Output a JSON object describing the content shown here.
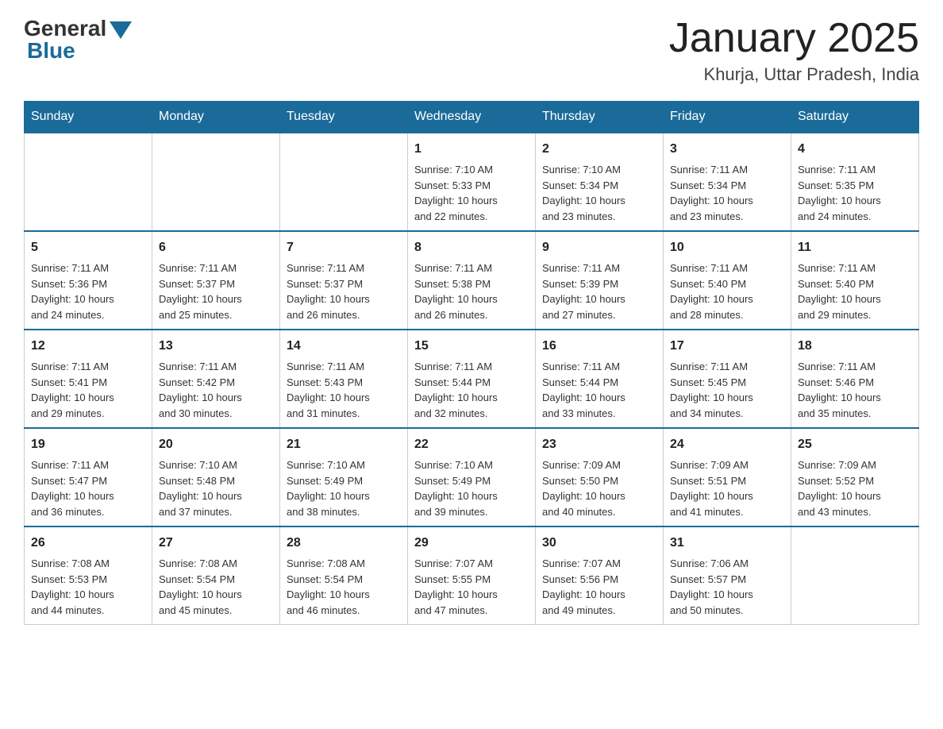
{
  "logo": {
    "general": "General",
    "blue": "Blue"
  },
  "title": "January 2025",
  "subtitle": "Khurja, Uttar Pradesh, India",
  "days": [
    "Sunday",
    "Monday",
    "Tuesday",
    "Wednesday",
    "Thursday",
    "Friday",
    "Saturday"
  ],
  "weeks": [
    [
      {
        "day": "",
        "info": ""
      },
      {
        "day": "",
        "info": ""
      },
      {
        "day": "",
        "info": ""
      },
      {
        "day": "1",
        "info": "Sunrise: 7:10 AM\nSunset: 5:33 PM\nDaylight: 10 hours\nand 22 minutes."
      },
      {
        "day": "2",
        "info": "Sunrise: 7:10 AM\nSunset: 5:34 PM\nDaylight: 10 hours\nand 23 minutes."
      },
      {
        "day": "3",
        "info": "Sunrise: 7:11 AM\nSunset: 5:34 PM\nDaylight: 10 hours\nand 23 minutes."
      },
      {
        "day": "4",
        "info": "Sunrise: 7:11 AM\nSunset: 5:35 PM\nDaylight: 10 hours\nand 24 minutes."
      }
    ],
    [
      {
        "day": "5",
        "info": "Sunrise: 7:11 AM\nSunset: 5:36 PM\nDaylight: 10 hours\nand 24 minutes."
      },
      {
        "day": "6",
        "info": "Sunrise: 7:11 AM\nSunset: 5:37 PM\nDaylight: 10 hours\nand 25 minutes."
      },
      {
        "day": "7",
        "info": "Sunrise: 7:11 AM\nSunset: 5:37 PM\nDaylight: 10 hours\nand 26 minutes."
      },
      {
        "day": "8",
        "info": "Sunrise: 7:11 AM\nSunset: 5:38 PM\nDaylight: 10 hours\nand 26 minutes."
      },
      {
        "day": "9",
        "info": "Sunrise: 7:11 AM\nSunset: 5:39 PM\nDaylight: 10 hours\nand 27 minutes."
      },
      {
        "day": "10",
        "info": "Sunrise: 7:11 AM\nSunset: 5:40 PM\nDaylight: 10 hours\nand 28 minutes."
      },
      {
        "day": "11",
        "info": "Sunrise: 7:11 AM\nSunset: 5:40 PM\nDaylight: 10 hours\nand 29 minutes."
      }
    ],
    [
      {
        "day": "12",
        "info": "Sunrise: 7:11 AM\nSunset: 5:41 PM\nDaylight: 10 hours\nand 29 minutes."
      },
      {
        "day": "13",
        "info": "Sunrise: 7:11 AM\nSunset: 5:42 PM\nDaylight: 10 hours\nand 30 minutes."
      },
      {
        "day": "14",
        "info": "Sunrise: 7:11 AM\nSunset: 5:43 PM\nDaylight: 10 hours\nand 31 minutes."
      },
      {
        "day": "15",
        "info": "Sunrise: 7:11 AM\nSunset: 5:44 PM\nDaylight: 10 hours\nand 32 minutes."
      },
      {
        "day": "16",
        "info": "Sunrise: 7:11 AM\nSunset: 5:44 PM\nDaylight: 10 hours\nand 33 minutes."
      },
      {
        "day": "17",
        "info": "Sunrise: 7:11 AM\nSunset: 5:45 PM\nDaylight: 10 hours\nand 34 minutes."
      },
      {
        "day": "18",
        "info": "Sunrise: 7:11 AM\nSunset: 5:46 PM\nDaylight: 10 hours\nand 35 minutes."
      }
    ],
    [
      {
        "day": "19",
        "info": "Sunrise: 7:11 AM\nSunset: 5:47 PM\nDaylight: 10 hours\nand 36 minutes."
      },
      {
        "day": "20",
        "info": "Sunrise: 7:10 AM\nSunset: 5:48 PM\nDaylight: 10 hours\nand 37 minutes."
      },
      {
        "day": "21",
        "info": "Sunrise: 7:10 AM\nSunset: 5:49 PM\nDaylight: 10 hours\nand 38 minutes."
      },
      {
        "day": "22",
        "info": "Sunrise: 7:10 AM\nSunset: 5:49 PM\nDaylight: 10 hours\nand 39 minutes."
      },
      {
        "day": "23",
        "info": "Sunrise: 7:09 AM\nSunset: 5:50 PM\nDaylight: 10 hours\nand 40 minutes."
      },
      {
        "day": "24",
        "info": "Sunrise: 7:09 AM\nSunset: 5:51 PM\nDaylight: 10 hours\nand 41 minutes."
      },
      {
        "day": "25",
        "info": "Sunrise: 7:09 AM\nSunset: 5:52 PM\nDaylight: 10 hours\nand 43 minutes."
      }
    ],
    [
      {
        "day": "26",
        "info": "Sunrise: 7:08 AM\nSunset: 5:53 PM\nDaylight: 10 hours\nand 44 minutes."
      },
      {
        "day": "27",
        "info": "Sunrise: 7:08 AM\nSunset: 5:54 PM\nDaylight: 10 hours\nand 45 minutes."
      },
      {
        "day": "28",
        "info": "Sunrise: 7:08 AM\nSunset: 5:54 PM\nDaylight: 10 hours\nand 46 minutes."
      },
      {
        "day": "29",
        "info": "Sunrise: 7:07 AM\nSunset: 5:55 PM\nDaylight: 10 hours\nand 47 minutes."
      },
      {
        "day": "30",
        "info": "Sunrise: 7:07 AM\nSunset: 5:56 PM\nDaylight: 10 hours\nand 49 minutes."
      },
      {
        "day": "31",
        "info": "Sunrise: 7:06 AM\nSunset: 5:57 PM\nDaylight: 10 hours\nand 50 minutes."
      },
      {
        "day": "",
        "info": ""
      }
    ]
  ]
}
